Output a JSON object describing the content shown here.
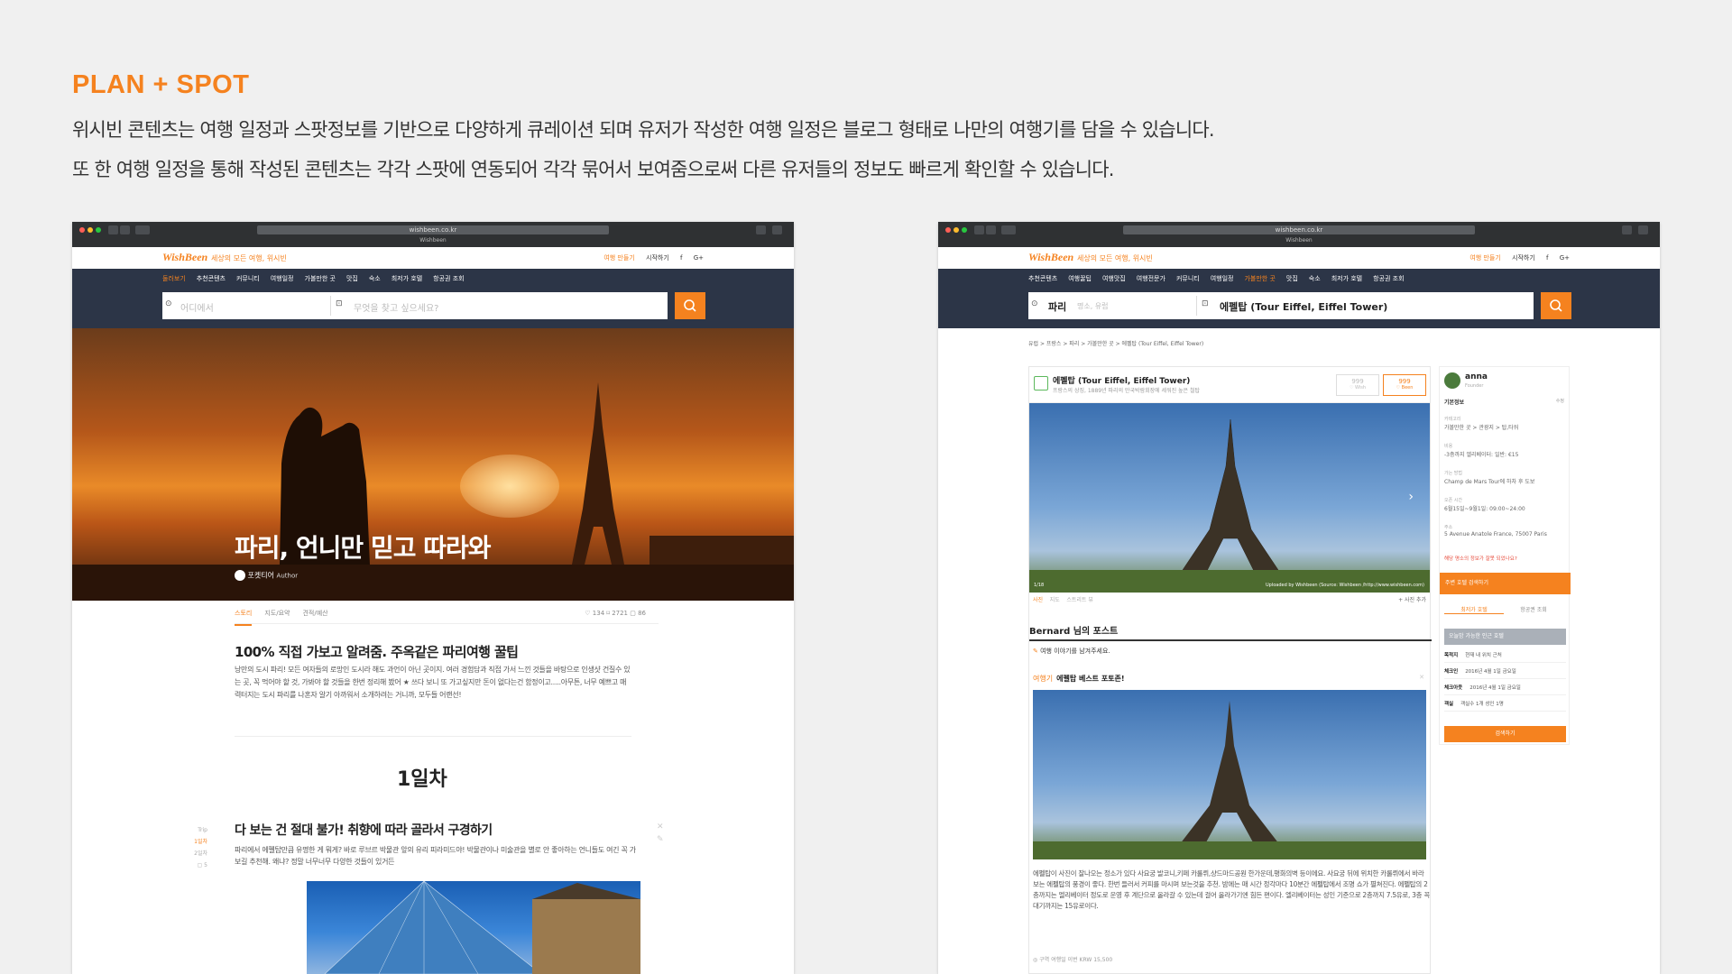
{
  "page": {
    "title": "PLAN + SPOT",
    "desc1": "위시빈 콘텐츠는 여행 일정과 스팟정보를 기반으로 다양하게 큐레이션 되며 유저가 작성한 여행 일정은 블로그 형태로 나만의 여행기를 담을 수 있습니다.",
    "desc2": "또 한 여행 일정을 통해 작성된 콘텐츠는 각각 스팟에 연동되어 각각 묶어서 보여줌으로써 다른 유저들의 정보도 빠르게 확인할 수 있습니다."
  },
  "browser": {
    "url": "wishbeen.co.kr",
    "tab": "Wishbeen"
  },
  "site": {
    "logo": "WishBeen",
    "slogan": "세상의 모든 여행, 위시빈",
    "top_links": [
      "여행 만들기",
      "시작하기",
      "f",
      "G+"
    ],
    "menu_left": [
      "둘러보기",
      "추천콘텐츠",
      "커뮤니티",
      "여행일정",
      "가볼만한 곳",
      "맛집",
      "숙소",
      "최저가 호텔",
      "항공권 조회"
    ],
    "menu_right": [
      "추천콘텐츠",
      "여행꿀팁",
      "여행맛집",
      "여행전문가",
      "커뮤니티",
      "여행일정",
      "가볼만한 곳",
      "맛집",
      "숙소",
      "최저가 호텔",
      "항공권 조회"
    ],
    "search_where_placeholder": "어디에서",
    "search_what_placeholder": "무엇을 찾고 싶으세요?",
    "search_where_value": "파리",
    "search_where_hint": "명소, 유럽",
    "search_what_value": "에펠탑 (Tour Eiffel, Eiffel Tower)"
  },
  "left": {
    "hero_title": "파리, 언니만 믿고 따라와",
    "author": "포켓티어",
    "author_role": "Author",
    "tabs": [
      "스토리",
      "지도/요약",
      "견적/예산"
    ],
    "stats": "♡ 134   ⌑ 2721   ▢ 86",
    "post_title": "100% 직접 가보고 알려줌. 주옥같은 파리여행 꿀팁",
    "post_body": "낭만의 도시 파리! 모든 여자들의 로망인 도시라 해도 과언이 아닌 곳이지. 여러 경험담과 직접 가서 느낀 것들을 바탕으로 인생샷 건질수 있는 곳, 꼭 먹어야 할 것, 가봐야 할 것들을 한번 정리해 봤어 ★ 쓰다 보니 또 가고싶지만 돈이 없다는건 함정이고.....아무튼, 너무 예쁘고 매력터지는 도시 파리를 나혼자 알기 아까워서 소개하려는 거니까, 모두들 어랜선!",
    "day": "1일차",
    "timeline": [
      "Trip",
      "1일차",
      "2일차",
      "▢ 5"
    ],
    "item_title": "다 보는 건 절대 불가! 취향에 따라 골라서 구경하기",
    "item_body": "파리에서 에펠탑만큼 유명한 게 뭐게? 바로 루브르 박물관 앞의 유리 피라미드야! 박물관이나 미술관을 별로 안 좋아하는 언니들도 여긴 꼭 가보길 추천해. 왜냐? 정말 너무너무 다양한 것들이 있거든"
  },
  "right": {
    "breadcrumb": "유럽 > 프랑스 > 파리 > 가볼만한 곳 > 에펠탑 (Tour Eiffel, Eiffel Tower)",
    "spot_title": "에펠탑 (Tour Eiffel, Eiffel Tower)",
    "spot_sub": "프랑스의 상징, 1889년 파리의 만국박람회장에 세워진 높은 철탑",
    "wish_count": "999",
    "wish_label": "♡ Wish",
    "been_count": "999",
    "been_label": "♡ Been",
    "photo_counter": "1/18",
    "photo_caption": "Uploaded by Wishbeen (Source: Wishbeen /http://www.wishbeen.com)",
    "photo_tabs": [
      "사진",
      "지도",
      "스트리트 뷰"
    ],
    "add_photo": "+ 사진 추가",
    "post_section": "Bernard 님의 포스트",
    "write_prompt": "여행 이야기를 남겨주세요.",
    "subpost_tag": "여행기",
    "subpost_title": "에펠탑 베스트 포토존!",
    "long_text": "에펠탑이 사진이 잘나오는 정소가 있다 사요궁 발코니,키페 카룰뤼,샹드마드공원 한가운데,평화의벽 등이에요. 사요궁 뒤에 위치한 카룰뤼에서 바라보는 에펠탑의 풍경이 좋다. 한번 들러서 커피를 마시며 보는것을 추천. 밤에는 매 시간 정각마다 10분간 에펠탑에서 조명 쇼가 펼쳐진다. 에펠탑의 2층까지는 엘리베이터 정도로 운영 후 계단으로 올라갈 수 있는데 걸어 올라가기엔 힘든 편이다. 엘리베이터는 성인 기준으로 2층까지 7.5유로, 3층 꼭대기까지는 15유로이다.",
    "footer": "◎ 구역   여행일 이번   KRW 15,500",
    "user_name": "anna",
    "user_role": "Founder",
    "basic_info": "기본정보",
    "edit": "수정",
    "info": [
      {
        "label": "카테고리",
        "value": "가볼만한 곳 > 관광지 > 탑,타워"
      },
      {
        "label": "비용",
        "value": "-3층까지 엘리베이터: 일반: €15"
      },
      {
        "label": "가는 방법",
        "value": "Champ de Mars Tour에 하차 후 도보"
      },
      {
        "label": "오픈 시간",
        "value": "6월15일~9월1일: 09:00~24:00"
      },
      {
        "label": "주소",
        "value": "5 Avenue Anatole France, 75007 Paris"
      }
    ],
    "report": "해당 명소의 정보가 잘못 되었나요?",
    "nearby": "주변 호텔 검색하기",
    "book_tabs": [
      "최저가 호텔",
      "항공권 조회"
    ],
    "hotel_search": "오늘밤 가능한 인근 호텔",
    "dest_label": "목적지",
    "dest_value": "현재 내 위치 근처",
    "checkin_label": "체크인",
    "checkin_value": "2016년 4월 1일 금요일",
    "checkout_label": "체크아웃",
    "checkout_value": "2016년 4월 1일 금요일",
    "room_label": "객실",
    "room_value": "객실수 1개 성인 1명",
    "search_btn": "검색하기"
  },
  "colors": {
    "accent": "#f5821f",
    "nav": "#2c3547",
    "background": "#f0f0f0"
  }
}
